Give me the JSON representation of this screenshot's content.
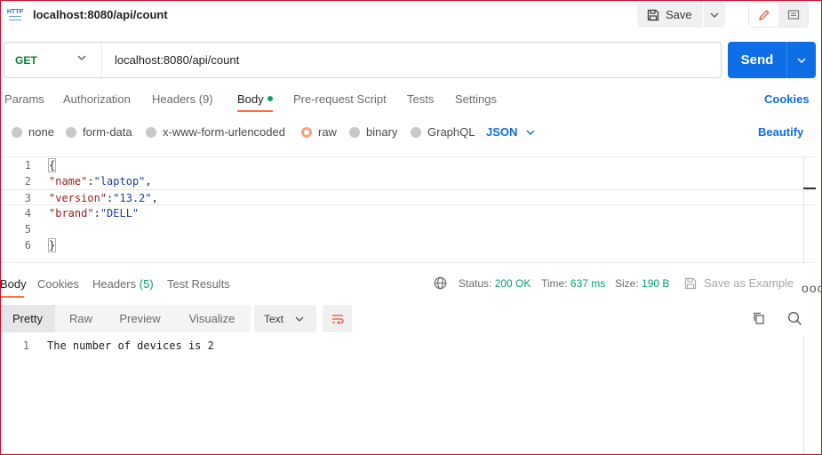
{
  "titlebar": {
    "title": "localhost:8080/api/count",
    "save_label": "Save",
    "icon": "http-icon"
  },
  "request": {
    "method": "GET",
    "url": "localhost:8080/api/count",
    "send_label": "Send"
  },
  "request_tabs": [
    {
      "label": "Params"
    },
    {
      "label": "Authorization"
    },
    {
      "label": "Headers (9)"
    },
    {
      "label": "Body",
      "active": true
    },
    {
      "label": "Pre-request Script"
    },
    {
      "label": "Tests"
    },
    {
      "label": "Settings"
    }
  ],
  "cookies_label": "Cookies",
  "body_types": [
    {
      "label": "none"
    },
    {
      "label": "form-data"
    },
    {
      "label": "x-www-form-urlencoded"
    },
    {
      "label": "raw",
      "selected": true
    },
    {
      "label": "binary"
    },
    {
      "label": "GraphQL"
    }
  ],
  "raw_format": "JSON",
  "beautify_label": "Beautify",
  "editor": {
    "lines": [
      {
        "n": "1",
        "text": "{"
      },
      {
        "n": "2",
        "key": "\"name\"",
        "sep": ":",
        "value": "\"laptop\"",
        "end": ","
      },
      {
        "n": "3",
        "key": "\"version\"",
        "sep": ":",
        "value": "\"13.2\"",
        "end": ","
      },
      {
        "n": "4",
        "key": "\"brand\"",
        "sep": ":",
        "value": "\"DELL\"",
        "end": ""
      },
      {
        "n": "5",
        "text": ""
      },
      {
        "n": "6",
        "text": "}"
      }
    ]
  },
  "response": {
    "tabs": [
      {
        "label": "Body",
        "active": true
      },
      {
        "label": "Cookies"
      },
      {
        "label": "Headers",
        "count": "(5)"
      },
      {
        "label": "Test Results"
      }
    ],
    "status_label": "Status:",
    "status_value": "200 OK",
    "time_label": "Time:",
    "time_value": "637 ms",
    "size_label": "Size:",
    "size_value": "190 B",
    "save_example_label": "Save as Example",
    "more_label": "ooo",
    "view_tabs": [
      "Pretty",
      "Raw",
      "Preview",
      "Visualize"
    ],
    "text_format": "Text",
    "lines": [
      {
        "n": "1",
        "text": "The number of devices is 2"
      }
    ]
  },
  "colors": {
    "accent": "#ff6c37",
    "send": "#0d6ee6",
    "success": "#0aa06e",
    "method_get": "#0b7a3e"
  }
}
